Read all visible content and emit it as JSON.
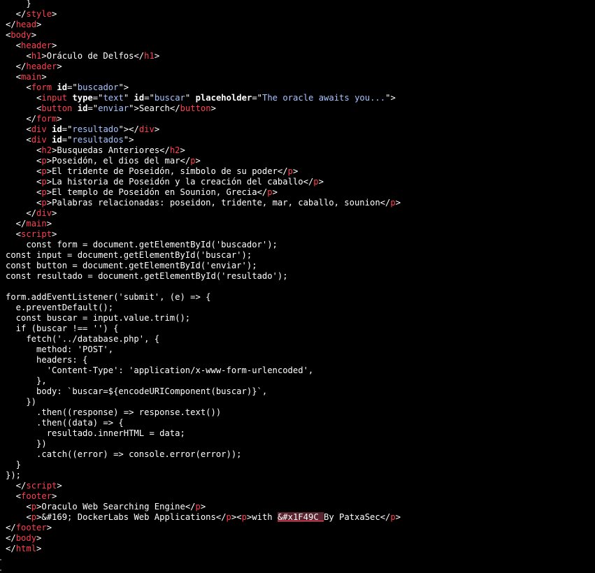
{
  "colors": {
    "background": "#000000",
    "tag": "#ff3f4f",
    "attribute": "#ffffff",
    "string": "#a8c4ff",
    "text": "#ffffff",
    "highlight": "#5a2330"
  },
  "lines": [
    [
      {
        "t": "p",
        "v": "    }"
      }
    ],
    [
      {
        "t": "p",
        "v": "  </"
      },
      {
        "t": "tag",
        "v": "style"
      },
      {
        "t": "p",
        "v": ">"
      }
    ],
    [
      {
        "t": "p",
        "v": "</"
      },
      {
        "t": "tag",
        "v": "head"
      },
      {
        "t": "p",
        "v": ">"
      }
    ],
    [
      {
        "t": "p",
        "v": "<"
      },
      {
        "t": "tag",
        "v": "body"
      },
      {
        "t": "p",
        "v": ">"
      }
    ],
    [
      {
        "t": "p",
        "v": "  <"
      },
      {
        "t": "tag",
        "v": "header"
      },
      {
        "t": "p",
        "v": ">"
      }
    ],
    [
      {
        "t": "p",
        "v": "    <"
      },
      {
        "t": "tag",
        "v": "h1"
      },
      {
        "t": "p",
        "v": ">"
      },
      {
        "t": "text",
        "v": "Oráculo de Delfos"
      },
      {
        "t": "p",
        "v": "</"
      },
      {
        "t": "tag",
        "v": "h1"
      },
      {
        "t": "p",
        "v": ">"
      }
    ],
    [
      {
        "t": "p",
        "v": "  </"
      },
      {
        "t": "tag",
        "v": "header"
      },
      {
        "t": "p",
        "v": ">"
      }
    ],
    [
      {
        "t": "p",
        "v": "  <"
      },
      {
        "t": "tag",
        "v": "main"
      },
      {
        "t": "p",
        "v": ">"
      }
    ],
    [
      {
        "t": "p",
        "v": "    <"
      },
      {
        "t": "tag",
        "v": "form"
      },
      {
        "t": "p",
        "v": " "
      },
      {
        "t": "attr",
        "v": "id"
      },
      {
        "t": "p",
        "v": "=\""
      },
      {
        "t": "str",
        "v": "buscador"
      },
      {
        "t": "p",
        "v": "\">"
      }
    ],
    [
      {
        "t": "p",
        "v": "      <"
      },
      {
        "t": "tag",
        "v": "input"
      },
      {
        "t": "p",
        "v": " "
      },
      {
        "t": "attr",
        "v": "type"
      },
      {
        "t": "p",
        "v": "=\""
      },
      {
        "t": "str",
        "v": "text"
      },
      {
        "t": "p",
        "v": "\" "
      },
      {
        "t": "attr",
        "v": "id"
      },
      {
        "t": "p",
        "v": "=\""
      },
      {
        "t": "str",
        "v": "buscar"
      },
      {
        "t": "p",
        "v": "\" "
      },
      {
        "t": "attr",
        "v": "placeholder"
      },
      {
        "t": "p",
        "v": "=\""
      },
      {
        "t": "str",
        "v": "The oracle awaits you..."
      },
      {
        "t": "p",
        "v": "\">"
      }
    ],
    [
      {
        "t": "p",
        "v": "      <"
      },
      {
        "t": "tag",
        "v": "button"
      },
      {
        "t": "p",
        "v": " "
      },
      {
        "t": "attr",
        "v": "id"
      },
      {
        "t": "p",
        "v": "=\""
      },
      {
        "t": "str",
        "v": "enviar"
      },
      {
        "t": "p",
        "v": "\">"
      },
      {
        "t": "text",
        "v": "Search"
      },
      {
        "t": "p",
        "v": "</"
      },
      {
        "t": "tag",
        "v": "button"
      },
      {
        "t": "p",
        "v": ">"
      }
    ],
    [
      {
        "t": "p",
        "v": "    </"
      },
      {
        "t": "tag",
        "v": "form"
      },
      {
        "t": "p",
        "v": ">"
      }
    ],
    [
      {
        "t": "p",
        "v": "    <"
      },
      {
        "t": "tag",
        "v": "div"
      },
      {
        "t": "p",
        "v": " "
      },
      {
        "t": "attr",
        "v": "id"
      },
      {
        "t": "p",
        "v": "=\""
      },
      {
        "t": "str",
        "v": "resultado"
      },
      {
        "t": "p",
        "v": "\"></"
      },
      {
        "t": "tag",
        "v": "div"
      },
      {
        "t": "p",
        "v": ">"
      }
    ],
    [
      {
        "t": "p",
        "v": "    <"
      },
      {
        "t": "tag",
        "v": "div"
      },
      {
        "t": "p",
        "v": " "
      },
      {
        "t": "attr",
        "v": "id"
      },
      {
        "t": "p",
        "v": "=\""
      },
      {
        "t": "str",
        "v": "resultados"
      },
      {
        "t": "p",
        "v": "\">"
      }
    ],
    [
      {
        "t": "p",
        "v": "      <"
      },
      {
        "t": "tag",
        "v": "h2"
      },
      {
        "t": "p",
        "v": ">"
      },
      {
        "t": "text",
        "v": "Busquedas Anteriores"
      },
      {
        "t": "p",
        "v": "</"
      },
      {
        "t": "tag",
        "v": "h2"
      },
      {
        "t": "p",
        "v": ">"
      }
    ],
    [
      {
        "t": "p",
        "v": "      <"
      },
      {
        "t": "tag",
        "v": "p"
      },
      {
        "t": "p",
        "v": ">"
      },
      {
        "t": "text",
        "v": "Poseidón, el dios del mar"
      },
      {
        "t": "p",
        "v": "</"
      },
      {
        "t": "tag",
        "v": "p"
      },
      {
        "t": "p",
        "v": ">"
      }
    ],
    [
      {
        "t": "p",
        "v": "      <"
      },
      {
        "t": "tag",
        "v": "p"
      },
      {
        "t": "p",
        "v": ">"
      },
      {
        "t": "text",
        "v": "El tridente de Poseidón, símbolo de su poder"
      },
      {
        "t": "p",
        "v": "</"
      },
      {
        "t": "tag",
        "v": "p"
      },
      {
        "t": "p",
        "v": ">"
      }
    ],
    [
      {
        "t": "p",
        "v": "      <"
      },
      {
        "t": "tag",
        "v": "p"
      },
      {
        "t": "p",
        "v": ">"
      },
      {
        "t": "text",
        "v": "La historia de Poseidón y la creación del caballo"
      },
      {
        "t": "p",
        "v": "</"
      },
      {
        "t": "tag",
        "v": "p"
      },
      {
        "t": "p",
        "v": ">"
      }
    ],
    [
      {
        "t": "p",
        "v": "      <"
      },
      {
        "t": "tag",
        "v": "p"
      },
      {
        "t": "p",
        "v": ">"
      },
      {
        "t": "text",
        "v": "El templo de Poseidón en Sounion, Grecia"
      },
      {
        "t": "p",
        "v": "</"
      },
      {
        "t": "tag",
        "v": "p"
      },
      {
        "t": "p",
        "v": ">"
      }
    ],
    [
      {
        "t": "p",
        "v": "      <"
      },
      {
        "t": "tag",
        "v": "p"
      },
      {
        "t": "p",
        "v": ">"
      },
      {
        "t": "text",
        "v": "Palabras relacionadas: poseidon, tridente, mar, caballo, sounion"
      },
      {
        "t": "p",
        "v": "</"
      },
      {
        "t": "tag",
        "v": "p"
      },
      {
        "t": "p",
        "v": ">"
      }
    ],
    [
      {
        "t": "p",
        "v": "    </"
      },
      {
        "t": "tag",
        "v": "div"
      },
      {
        "t": "p",
        "v": ">"
      }
    ],
    [
      {
        "t": "p",
        "v": "  </"
      },
      {
        "t": "tag",
        "v": "main"
      },
      {
        "t": "p",
        "v": ">"
      }
    ],
    [
      {
        "t": "p",
        "v": "  <"
      },
      {
        "t": "tag",
        "v": "script"
      },
      {
        "t": "p",
        "v": ">"
      }
    ],
    [
      {
        "t": "text",
        "v": "    const form = document.getElementById('buscador');"
      }
    ],
    [
      {
        "t": "text",
        "v": "const input = document.getElementById('buscar');"
      }
    ],
    [
      {
        "t": "text",
        "v": "const button = document.getElementById('enviar');"
      }
    ],
    [
      {
        "t": "text",
        "v": "const resultado = document.getElementById('resultado');"
      }
    ],
    [
      {
        "t": "text",
        "v": ""
      }
    ],
    [
      {
        "t": "text",
        "v": "form.addEventListener('submit', (e) => {"
      }
    ],
    [
      {
        "t": "text",
        "v": "  e.preventDefault();"
      }
    ],
    [
      {
        "t": "text",
        "v": "  const buscar = input.value.trim();"
      }
    ],
    [
      {
        "t": "text",
        "v": "  if (buscar !== '') {"
      }
    ],
    [
      {
        "t": "text",
        "v": "    fetch('../database.php', {"
      }
    ],
    [
      {
        "t": "text",
        "v": "      method: 'POST',"
      }
    ],
    [
      {
        "t": "text",
        "v": "      headers: {"
      }
    ],
    [
      {
        "t": "text",
        "v": "        'Content-Type': 'application/x-www-form-urlencoded',"
      }
    ],
    [
      {
        "t": "text",
        "v": "      },"
      }
    ],
    [
      {
        "t": "text",
        "v": "      body: `buscar=${encodeURIComponent(buscar)}`,"
      }
    ],
    [
      {
        "t": "text",
        "v": "    })"
      }
    ],
    [
      {
        "t": "text",
        "v": "      .then((response) => response.text())"
      }
    ],
    [
      {
        "t": "text",
        "v": "      .then((data) => {"
      }
    ],
    [
      {
        "t": "text",
        "v": "        resultado.innerHTML = data;"
      }
    ],
    [
      {
        "t": "text",
        "v": "      })"
      }
    ],
    [
      {
        "t": "text",
        "v": "      .catch((error) => console.error(error));"
      }
    ],
    [
      {
        "t": "text",
        "v": "  }"
      }
    ],
    [
      {
        "t": "text",
        "v": "});"
      }
    ],
    [
      {
        "t": "p",
        "v": "  </"
      },
      {
        "t": "tag",
        "v": "script"
      },
      {
        "t": "p",
        "v": ">"
      }
    ],
    [
      {
        "t": "p",
        "v": "  <"
      },
      {
        "t": "tag",
        "v": "footer"
      },
      {
        "t": "p",
        "v": ">"
      }
    ],
    [
      {
        "t": "p",
        "v": "    <"
      },
      {
        "t": "tag",
        "v": "p"
      },
      {
        "t": "p",
        "v": ">"
      },
      {
        "t": "text",
        "v": "Oraculo Web Searching Engine"
      },
      {
        "t": "p",
        "v": "</"
      },
      {
        "t": "tag",
        "v": "p"
      },
      {
        "t": "p",
        "v": ">"
      }
    ],
    [
      {
        "t": "p",
        "v": "    <"
      },
      {
        "t": "tag",
        "v": "p"
      },
      {
        "t": "p",
        "v": ">"
      },
      {
        "t": "text",
        "v": "&#169; DockerLabs Web Applications"
      },
      {
        "t": "p",
        "v": "</"
      },
      {
        "t": "tag",
        "v": "p"
      },
      {
        "t": "p",
        "v": "><"
      },
      {
        "t": "tag",
        "v": "p"
      },
      {
        "t": "p",
        "v": ">"
      },
      {
        "t": "text",
        "v": "with "
      },
      {
        "t": "hl",
        "v": "&#x1F49C "
      },
      {
        "t": "text",
        "v": "By PatxaSec"
      },
      {
        "t": "p",
        "v": "</"
      },
      {
        "t": "tag",
        "v": "p"
      },
      {
        "t": "p",
        "v": ">"
      }
    ],
    [
      {
        "t": "p",
        "v": "</"
      },
      {
        "t": "tag",
        "v": "footer"
      },
      {
        "t": "p",
        "v": ">"
      }
    ],
    [
      {
        "t": "p",
        "v": "</"
      },
      {
        "t": "tag",
        "v": "body"
      },
      {
        "t": "p",
        "v": ">"
      }
    ],
    [
      {
        "t": "p",
        "v": "</"
      },
      {
        "t": "tag",
        "v": "html"
      },
      {
        "t": "p",
        "v": ">"
      }
    ]
  ]
}
